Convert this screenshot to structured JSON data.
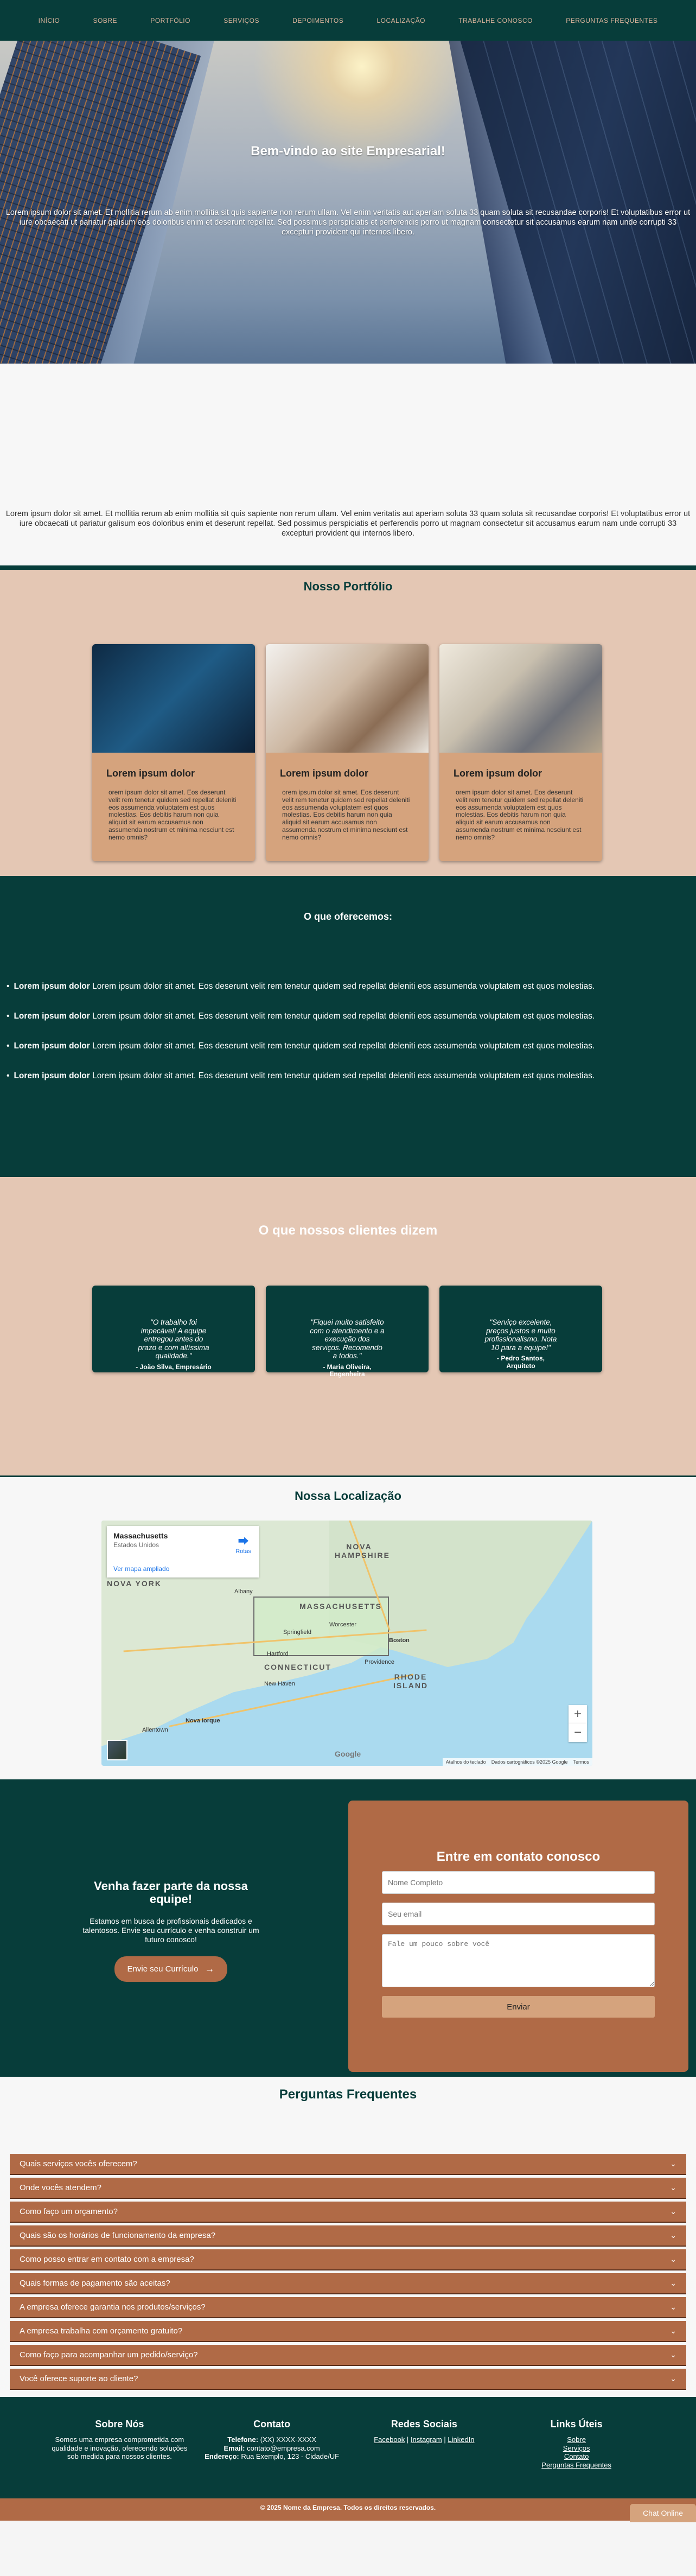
{
  "nav": [
    "INÍCIO",
    "SOBRE",
    "PORTFÓLIO",
    "SERVIÇOS",
    "DEPOIMENTOS",
    "LOCALIZAÇÃO",
    "TRABALHE CONOSCO",
    "PERGUNTAS FREQUENTES"
  ],
  "hero": {
    "title": "Bem-vindo ao site Empresarial!",
    "text": "Lorem ipsum dolor sit amet. Et mollitia rerum ab enim mollitia sit quis sapiente non rerum ullam. Vel enim veritatis aut aperiam soluta 33 quam soluta sit recusandae corporis! Et voluptatibus error ut iure obcaecati ut pariatur galisum eos doloribus enim et deserunt repellat. Sed possimus perspiciatis et perferendis porro ut magnam consectetur sit accusamus earum nam unde corrupti 33 excepturi provident qui internos libero."
  },
  "about": {
    "text": "Lorem ipsum dolor sit amet. Et mollitia rerum ab enim mollitia sit quis sapiente non rerum ullam. Vel enim veritatis aut aperiam soluta 33 quam soluta sit recusandae corporis! Et voluptatibus error ut iure obcaecati ut pariatur galisum eos doloribus enim et deserunt repellat. Sed possimus perspiciatis et perferendis porro ut magnam consectetur sit accusamus earum nam unde corrupti 33 excepturi provident qui internos libero."
  },
  "portfolio": {
    "title": "Nosso Portfólio",
    "cards": [
      {
        "title": "Lorem ipsum dolor",
        "text": "orem ipsum dolor sit amet. Eos deserunt velit rem tenetur quidem sed repellat deleniti eos assumenda voluptatem est quos molestias. Eos debitis harum non quia aliquid sit earum accusamus non assumenda nostrum et minima nesciunt est nemo omnis?"
      },
      {
        "title": "Lorem ipsum dolor",
        "text": "orem ipsum dolor sit amet. Eos deserunt velit rem tenetur quidem sed repellat deleniti eos assumenda voluptatem est quos molestias. Eos debitis harum non quia aliquid sit earum accusamus non assumenda nostrum et minima nesciunt est nemo omnis?"
      },
      {
        "title": "Lorem ipsum dolor",
        "text": "orem ipsum dolor sit amet. Eos deserunt velit rem tenetur quidem sed repellat deleniti eos assumenda voluptatem est quos molestias. Eos debitis harum non quia aliquid sit earum accusamus non assumenda nostrum et minima nesciunt est nemo omnis?"
      }
    ]
  },
  "services": {
    "title": "O que oferecemos:",
    "items": [
      {
        "bold": "Lorem ipsum dolor",
        "text": "Lorem ipsum dolor sit amet. Eos deserunt velit rem tenetur quidem sed repellat deleniti eos assumenda voluptatem est quos molestias."
      },
      {
        "bold": "Lorem ipsum dolor",
        "text": "Lorem ipsum dolor sit amet. Eos deserunt velit rem tenetur quidem sed repellat deleniti eos assumenda voluptatem est quos molestias."
      },
      {
        "bold": "Lorem ipsum dolor",
        "text": "Lorem ipsum dolor sit amet. Eos deserunt velit rem tenetur quidem sed repellat deleniti eos assumenda voluptatem est quos molestias."
      },
      {
        "bold": "Lorem ipsum dolor",
        "text": "Lorem ipsum dolor sit amet. Eos deserunt velit rem tenetur quidem sed repellat deleniti eos assumenda voluptatem est quos molestias."
      }
    ]
  },
  "testimonials": {
    "title": "O que nossos clientes dizem",
    "items": [
      {
        "quote": "\"O trabalho foi impecável! A equipe entregou antes do prazo e com altíssima qualidade.\"",
        "author": "- João Silva, Empresário"
      },
      {
        "quote": "\"Fiquei muito satisfeito com o atendimento e a execução dos serviços. Recomendo a todos.\"",
        "author": "- Maria Oliveira, Engenheira"
      },
      {
        "quote": "\"Serviço excelente, preços justos e muito profissionalismo. Nota 10 para a equipe!\"",
        "author": "- Pedro Santos, Arquiteto"
      }
    ]
  },
  "location": {
    "title": "Nossa Localização",
    "place": "Massachusetts",
    "country": "Estados Unidos",
    "directions": "Rotas",
    "bigger_map": "Ver mapa ampliado",
    "labels": {
      "ny": "NOVA YORK",
      "ma": "MASSACHUSETTS",
      "ct": "CONNECTICUT",
      "nh": "NOVA HAMPSHIRE",
      "ri": "RHODE ISLAND",
      "albany": "Albany",
      "boston": "Boston",
      "worcester": "Worcester",
      "springfield": "Springfield",
      "hartford": "Hartford",
      "providence": "Providence",
      "newhaven": "New Haven",
      "nyc": "Nova Iorque",
      "allentown": "Allentown"
    },
    "zoom_in": "+",
    "zoom_out": "−",
    "attribution": [
      "Atalhos do teclado",
      "Dados cartográficos ©2025 Google",
      "Termos"
    ],
    "google": "Google"
  },
  "work": {
    "title": "Venha fazer parte da nossa equipe!",
    "text": "Estamos em busca de profissionais dedicados e talentosos. Envie seu currículo e venha construir um futuro conosco!",
    "button": "Envie seu Currículo",
    "contact_title": "Entre em contato conosco",
    "name_placeholder": "Nome Completo",
    "email_placeholder": "Seu email",
    "message_placeholder": "Fale um pouco sobre você",
    "send": "Enviar"
  },
  "faq": {
    "title": "Perguntas Frequentes",
    "items": [
      "Quais serviços vocês oferecem?",
      "Onde vocês atendem?",
      "Como faço um orçamento?",
      "Quais são os horários de funcionamento da empresa?",
      "Como posso entrar em contato com a empresa?",
      "Quais formas de pagamento são aceitas?",
      "A empresa oferece garantia nos produtos/serviços?",
      "A empresa trabalha com orçamento gratuito?",
      "Como faço para acompanhar um pedido/serviço?",
      "Você oferece suporte ao cliente?"
    ]
  },
  "footer": {
    "about_title": "Sobre Nós",
    "about_text": "Somos uma empresa comprometida com qualidade e inovação, oferecendo soluções sob medida para nossos clientes.",
    "contact_title": "Contato",
    "phone_label": "Telefone:",
    "phone": "(XX) XXXX-XXXX",
    "email_label": "Email:",
    "email": "contato@empresa.com",
    "address_label": "Endereço:",
    "address": "Rua Exemplo, 123 - Cidade/UF",
    "social_title": "Redes Sociais",
    "social": [
      "Facebook",
      "Instagram",
      "LinkedIn"
    ],
    "sep": "|",
    "links_title": "Links Úteis",
    "links": [
      "Sobre",
      "Serviços",
      "Contato",
      "Perguntas Frequentes"
    ],
    "copyright": "© 2025 Nome da Empresa. Todos os direitos reservados.",
    "chat": "Chat Online"
  }
}
